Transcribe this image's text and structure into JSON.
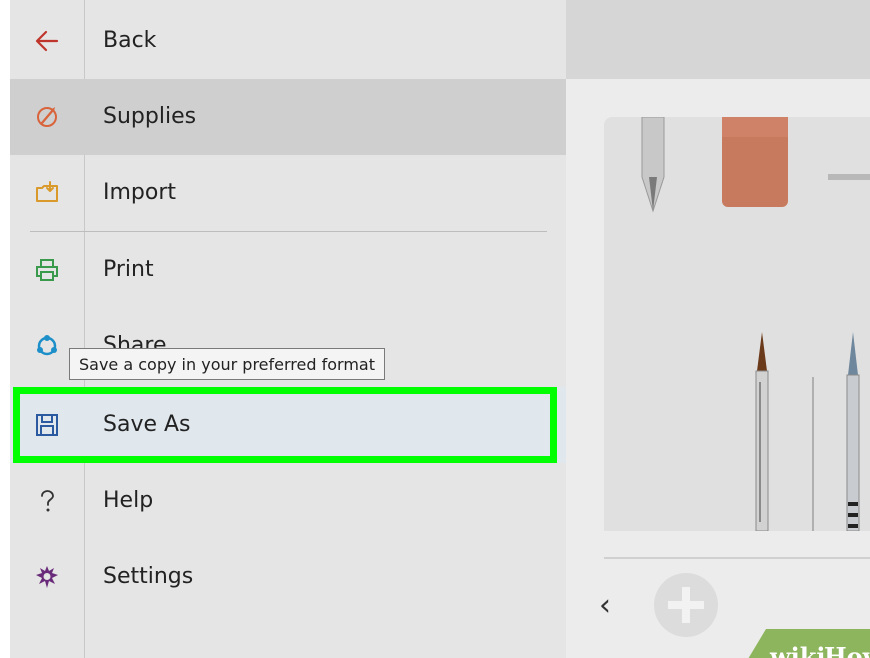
{
  "menu": {
    "items": [
      {
        "label": "Back",
        "icon": "back-arrow-icon"
      },
      {
        "label": "Supplies",
        "icon": "supplies-icon"
      },
      {
        "label": "Import",
        "icon": "import-icon"
      },
      {
        "label": "Print",
        "icon": "print-icon"
      },
      {
        "label": "Share",
        "icon": "share-icon"
      },
      {
        "label": "Save As",
        "icon": "save-icon"
      },
      {
        "label": "Help",
        "icon": "help-icon"
      },
      {
        "label": "Settings",
        "icon": "settings-icon"
      }
    ]
  },
  "tooltip": {
    "text": "Save a copy in your preferred format"
  },
  "watermark": {
    "prefix": "wiki",
    "suffix": "How"
  },
  "colors": {
    "highlight": "#00ff00",
    "back_icon": "#c0352b",
    "supplies_icon": "#d9633a",
    "import_icon": "#d99a2b",
    "print_icon": "#3a9a4b",
    "share_icon": "#1d8fc9",
    "save_icon": "#2c5aa0",
    "settings_icon": "#6a2c7a"
  }
}
